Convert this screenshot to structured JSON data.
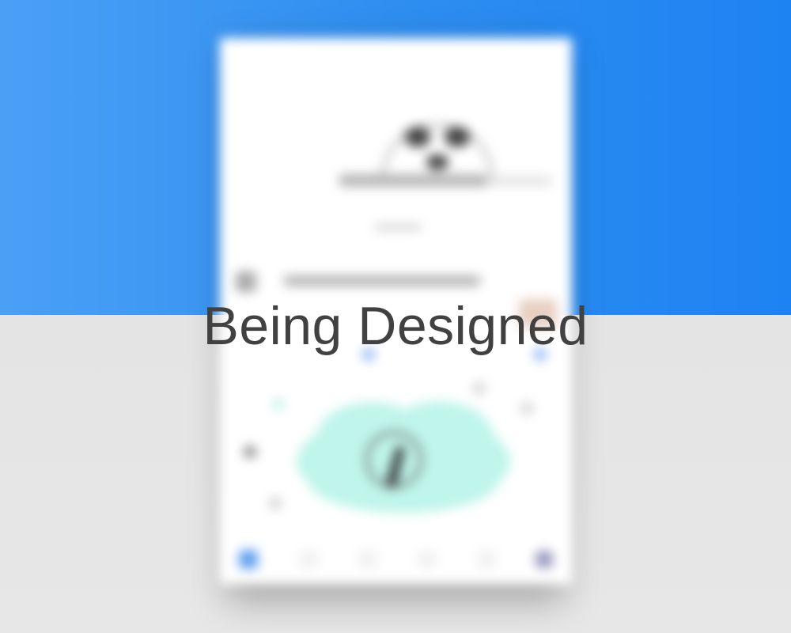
{
  "overlay": {
    "status_text": "Being Designed"
  },
  "colors": {
    "top_background": "#2f8ef0",
    "bottom_background": "#e3e3e3",
    "card_background": "#ffffff",
    "accent": "#2f8ef0",
    "cloud": "#bff5ea",
    "status_text": "#414141"
  },
  "icons": {
    "profile_avatar": "seal-icon",
    "center_illustration": "cloud-icon",
    "cloud_glyph": "mic-icon",
    "nav_primary": "pen-icon",
    "nav_secondary": "profile-icon"
  }
}
